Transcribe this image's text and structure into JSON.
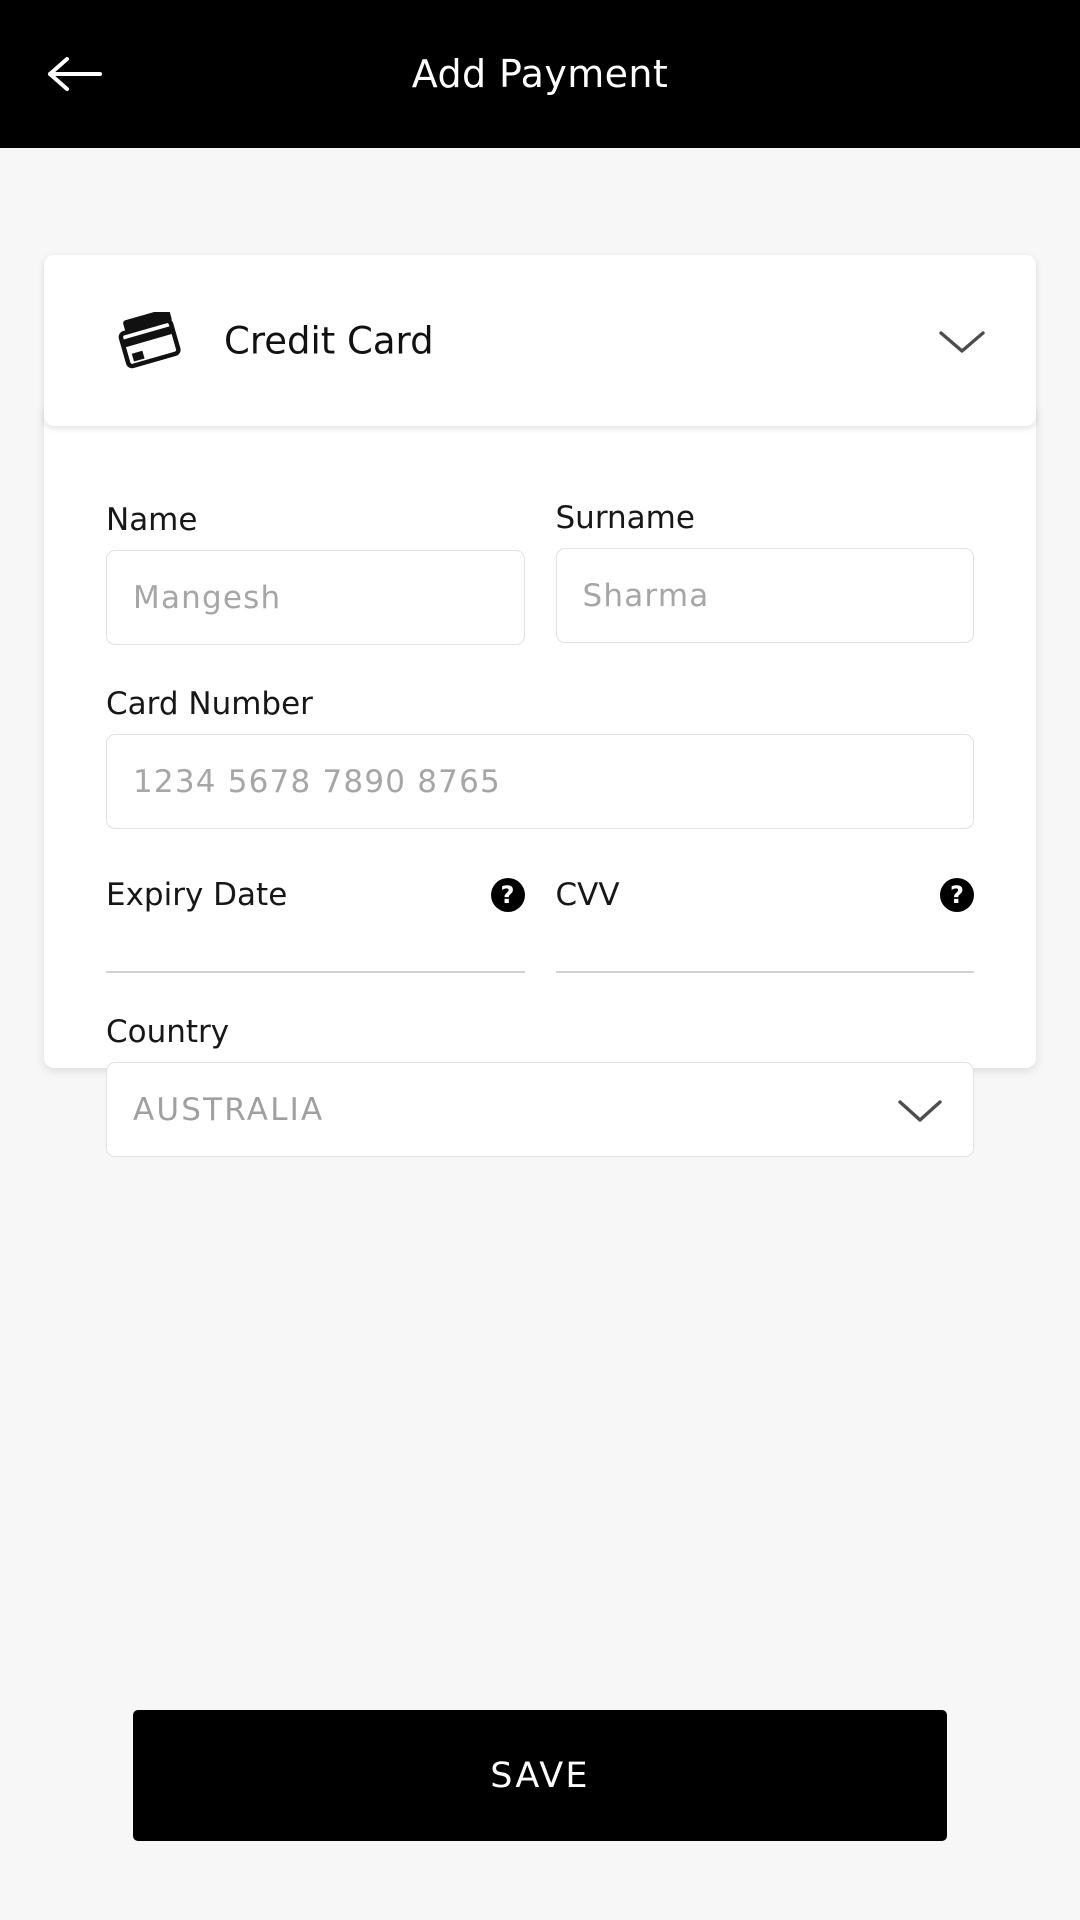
{
  "appbar": {
    "back_icon": "arrow-left-icon",
    "title": "Add Payment"
  },
  "method_selector": {
    "icon": "credit-card-icon",
    "label": "Credit Card",
    "chevron_icon": "chevron-down-icon"
  },
  "form": {
    "name": {
      "label": "Name",
      "placeholder": "Mangesh",
      "value": ""
    },
    "surname": {
      "label": "Surname",
      "placeholder": "Sharma",
      "value": ""
    },
    "card_number": {
      "label": "Card Number",
      "placeholder": "1234 5678 7890 8765",
      "value": ""
    },
    "expiry": {
      "label": "Expiry Date",
      "placeholder": "",
      "value": "",
      "help_icon": "question-mark-circle-icon"
    },
    "cvv": {
      "label": "CVV",
      "placeholder": "",
      "value": "",
      "help_icon": "question-mark-circle-icon"
    },
    "country": {
      "label": "Country",
      "value": "AUSTRALIA",
      "chevron_icon": "chevron-down-icon"
    }
  },
  "actions": {
    "save_label": "SAVE"
  },
  "colors": {
    "appbar_bg": "#000000",
    "page_bg": "#f7f7f7",
    "card_bg": "#ffffff",
    "primary": "#000000",
    "border": "#e2e2e2",
    "placeholder": "#a6a6a6"
  }
}
